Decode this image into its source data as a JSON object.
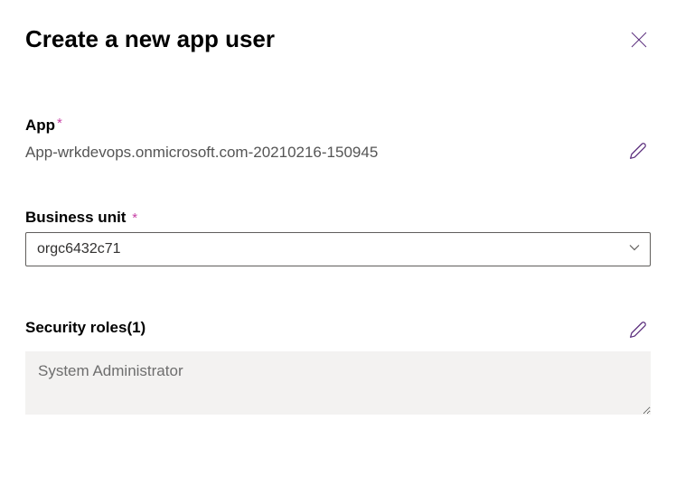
{
  "header": {
    "title": "Create a new app user"
  },
  "app": {
    "label": "App",
    "required_marker": "*",
    "value": "App-wrkdevops.onmicrosoft.com-20210216-150945"
  },
  "business_unit": {
    "label": "Business unit",
    "required_marker": "*",
    "value": "orgc6432c71"
  },
  "security_roles": {
    "label": "Security roles(1)",
    "value": "System Administrator"
  }
}
